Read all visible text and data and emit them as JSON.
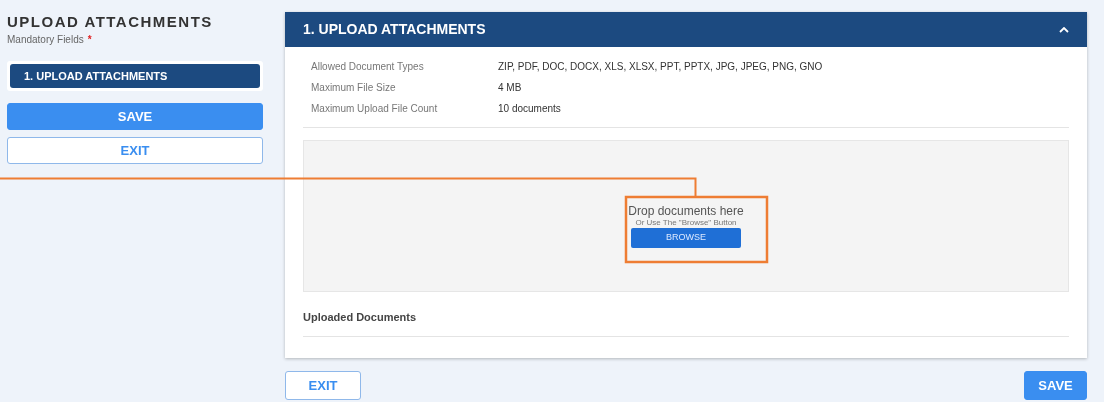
{
  "sidebar": {
    "title": "UPLOAD ATTACHMENTS",
    "mandatory_label": "Mandatory Fields",
    "required_mark": "*",
    "steps": [
      {
        "label": "1.  UPLOAD ATTACHMENTS",
        "selected": true
      }
    ],
    "buttons": [
      {
        "label": "SAVE",
        "kind": "primary"
      },
      {
        "label": "EXIT",
        "kind": "outline"
      }
    ]
  },
  "panel": {
    "title": "1. UPLOAD ATTACHMENTS",
    "expanded": true,
    "info": [
      {
        "label": "Allowed Document Types",
        "value": "ZIP, PDF, DOC, DOCX, XLS, XLSX, PPT, PPTX, JPG, JPEG, PNG, GNO"
      },
      {
        "label": "Maximum File Size",
        "value": "4 MB"
      },
      {
        "label": "Maximum Upload File Count",
        "value": "10 documents"
      }
    ],
    "dropzone": {
      "title": "Drop documents here",
      "hint": "Or Use The \"Browse\" Button",
      "button": "BROWSE"
    },
    "uploaded_heading": "Uploaded Documents"
  },
  "footer": {
    "buttons": [
      {
        "label": "EXIT",
        "kind": "outline"
      },
      {
        "label": "SAVE",
        "kind": "primary"
      }
    ]
  }
}
